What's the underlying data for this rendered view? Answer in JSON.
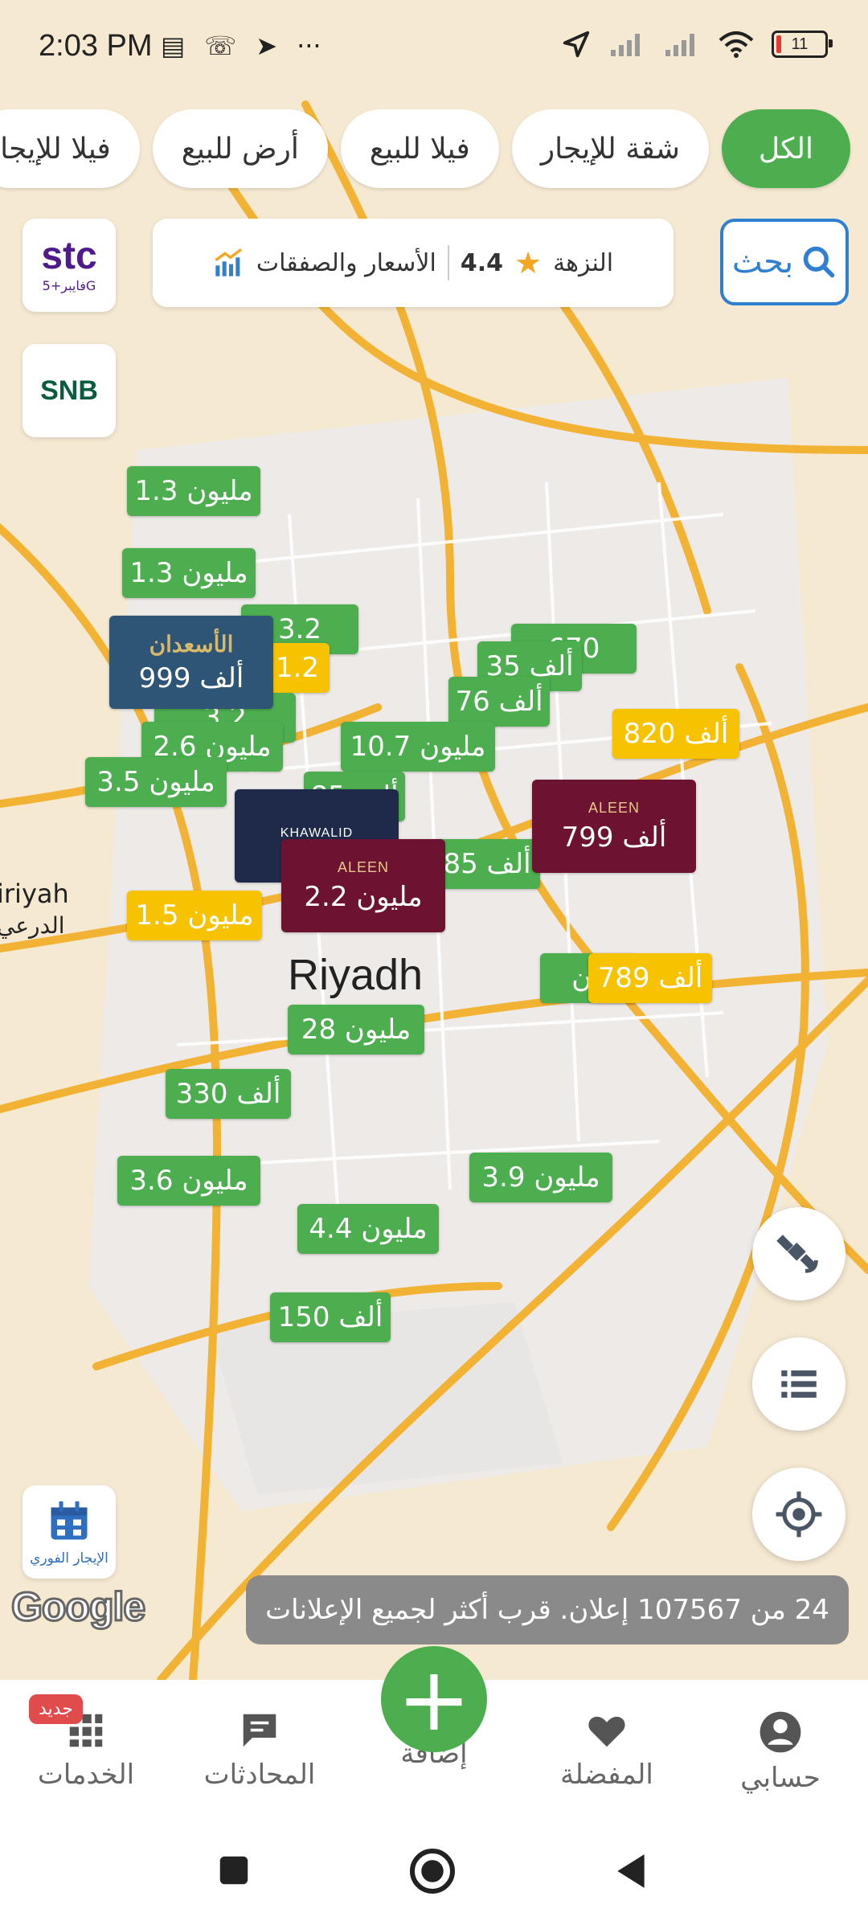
{
  "status_bar": {
    "time": "2:03 PM",
    "battery": "11"
  },
  "filters": [
    {
      "label": "الكل",
      "active": true
    },
    {
      "label": "شقة للإيجار",
      "active": false
    },
    {
      "label": "فيلا للبيع",
      "active": false
    },
    {
      "label": "أرض للبيع",
      "active": false
    },
    {
      "label": "فيلا للإيجا",
      "active": false
    }
  ],
  "search": {
    "label": "بحث"
  },
  "info_card": {
    "location": "النزهة",
    "rating": "4.4",
    "prices_label": "الأسعار والصفقات"
  },
  "logos": {
    "stc": "stc",
    "stc_sub": "فايبر+5G",
    "snb": "SNB"
  },
  "map": {
    "city": "Riyadh",
    "place_en": "iriyah",
    "place_ar": "الدرعي",
    "pins": [
      {
        "label": "1.3 مليون",
        "color": "green"
      },
      {
        "label": "1.3 مليون",
        "color": "green"
      },
      {
        "label": "1.2",
        "color": "yellow"
      },
      {
        "label": "3.2",
        "color": "green"
      },
      {
        "label": "2.6 مليون",
        "color": "green"
      },
      {
        "label": "3.5 مليون",
        "color": "green"
      },
      {
        "label": "670",
        "color": "green"
      },
      {
        "label": "35 ألف",
        "color": "green"
      },
      {
        "label": "76 ألف",
        "color": "green"
      },
      {
        "label": "10.7 مليون",
        "color": "green"
      },
      {
        "label": "820 ألف",
        "color": "yellow"
      },
      {
        "label": "85 ألف",
        "color": "green"
      },
      {
        "label": "1.5 مليون",
        "color": "yellow"
      },
      {
        "label": "ون",
        "color": "green"
      },
      {
        "label": "789 ألف",
        "color": "yellow"
      },
      {
        "label": "28 مليون",
        "color": "green"
      },
      {
        "label": "330 ألف",
        "color": "green"
      },
      {
        "label": "3.6 مليون",
        "color": "green"
      },
      {
        "label": "3.9 مليون",
        "color": "green"
      },
      {
        "label": "4.4 مليون",
        "color": "green"
      },
      {
        "label": "150 ألف",
        "color": "green"
      }
    ],
    "brand_pins": [
      {
        "brand": "الأسعدان",
        "label": "999 ألف"
      },
      {
        "brand": "KHAWALID",
        "label": ""
      },
      {
        "brand": "ALEEN",
        "label": "2.2 مليون"
      },
      {
        "brand": "ALEEN",
        "label": "799 ألف"
      }
    ]
  },
  "quick_rent": "الإيجار الفوري",
  "google": "Google",
  "toast": "24 من 107567 إعلان. قرب أكثر لجميع الإعلانات",
  "nav": {
    "services": "الخدمات",
    "new_badge": "جديد",
    "chats": "المحادثات",
    "add": "إضافة",
    "favorites": "المفضلة",
    "account": "حسابي"
  },
  "colors": {
    "green": "#4cae4f",
    "yellow": "#f7c200",
    "blue": "#2f80d1",
    "maroon": "#6d1230"
  }
}
